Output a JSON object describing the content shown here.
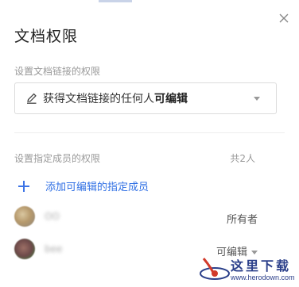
{
  "dialog": {
    "title": "文档权限",
    "close_icon": "close-icon"
  },
  "link_section": {
    "label": "设置文档链接的权限",
    "select": {
      "icon": "pencil-icon",
      "prefix": "获得文档链接的任何人",
      "value": "可编辑"
    }
  },
  "members_section": {
    "label": "设置指定成员的权限",
    "count": "共2人",
    "add_label": "添加可编辑的指定成员",
    "add_icon": "plus-icon",
    "members": [
      {
        "name": "OO",
        "role": "所有者"
      },
      {
        "name": "bee",
        "role": "可编辑"
      }
    ]
  },
  "watermark": {
    "text": "这里下载",
    "url": "www.herodown.com"
  },
  "colors": {
    "accent": "#2f6fe4",
    "muted": "#999999",
    "watermark": "#2b3f8a"
  }
}
